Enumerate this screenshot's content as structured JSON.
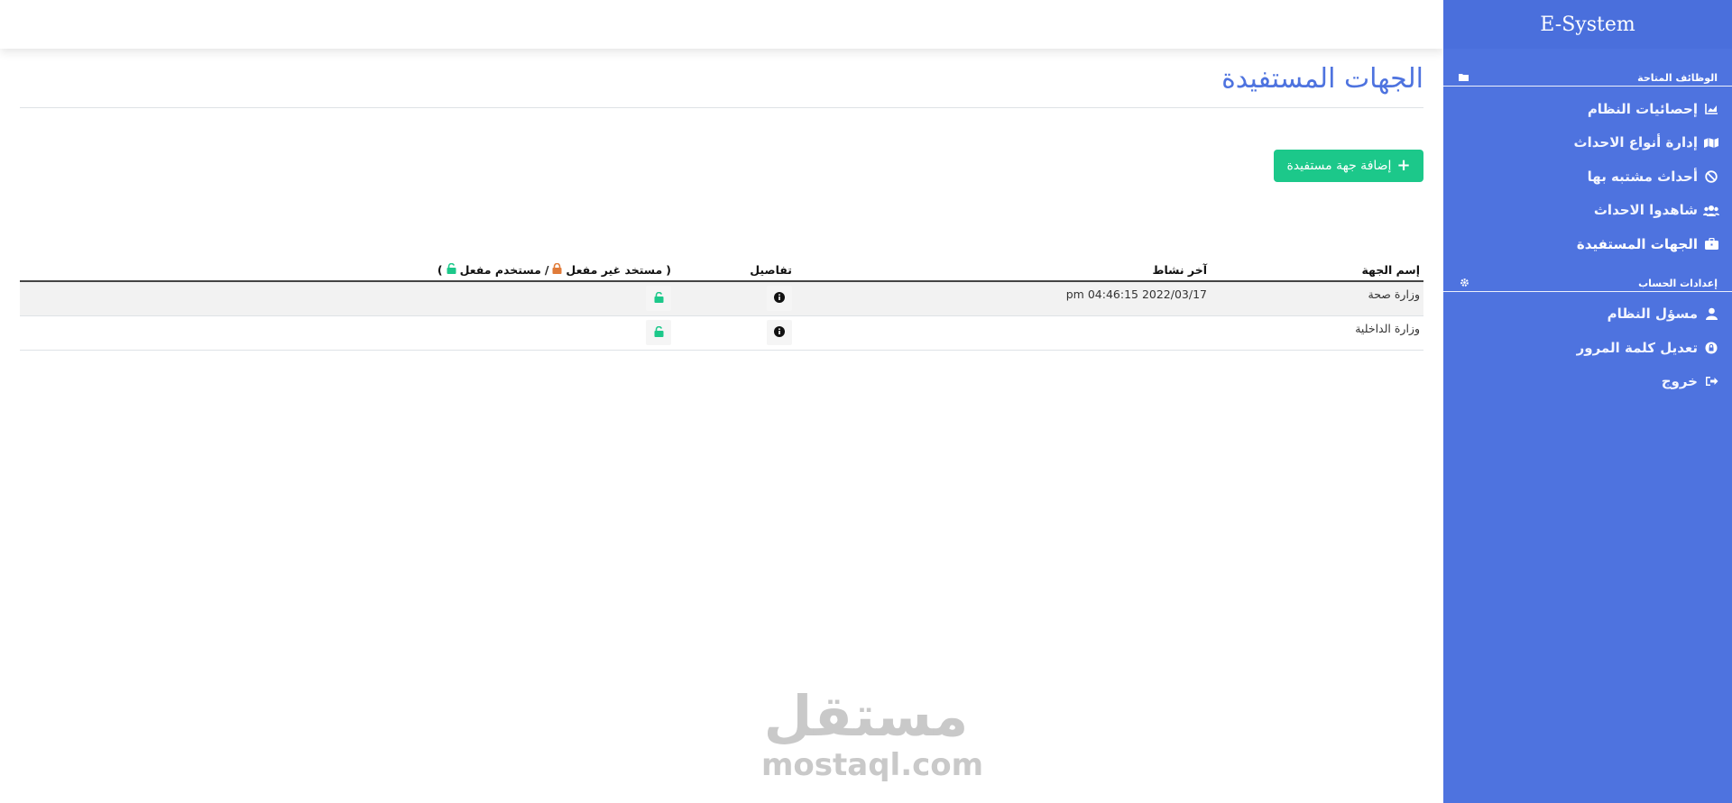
{
  "brand": {
    "title": "E-System"
  },
  "sidebar": {
    "section1": {
      "heading": "الوظائف المتاحة",
      "icon": "folder-open-icon"
    },
    "items1": [
      {
        "label": "إحصائيات النظام",
        "icon": "chart-area-icon"
      },
      {
        "label": "إدارة أنواع الاحداث",
        "icon": "map-icon"
      },
      {
        "label": "أحداث مشتبه بها",
        "icon": "ban-icon"
      },
      {
        "label": "شاهدوا الاحداث",
        "icon": "users-icon"
      },
      {
        "label": "الجهات المستفيدة",
        "icon": "briefcase-icon",
        "active": true
      }
    ],
    "section2": {
      "heading": "إعدادات الحساب",
      "icon": "gear-icon"
    },
    "items2": [
      {
        "label": "مسؤل النظام",
        "icon": "user-icon"
      },
      {
        "label": "تعديل كلمة المرور",
        "icon": "lock-icon"
      },
      {
        "label": "خروج",
        "icon": "sign-out-icon"
      }
    ]
  },
  "page": {
    "title": "الجهات المستفيدة",
    "add_button": "إضافة جهة مستفيدة"
  },
  "table": {
    "headers": {
      "name": "إسم الجهة",
      "last_activity": "آخر نشاط",
      "details": "تفاصيل",
      "status_open": "(",
      "status_inactive": "مستخد غير مفعل",
      "status_sep": "/",
      "status_active": "مستخدم مفعل",
      "status_close": ")"
    },
    "rows": [
      {
        "name": "وزارة صحة",
        "last_activity": "pm 04:46:15 2022/03/17",
        "status": "active"
      },
      {
        "name": "وزارة الداخلية",
        "last_activity": "",
        "status": "active"
      }
    ]
  },
  "colors": {
    "sidebar": "#4e73df",
    "title": "#4e73df",
    "add_button": "#1cc88a",
    "unlock_icon": "#1cc88a",
    "lock_icon": "#e07b39"
  },
  "watermark": {
    "arabic": "مستقل",
    "latin": "mostaql.com"
  }
}
